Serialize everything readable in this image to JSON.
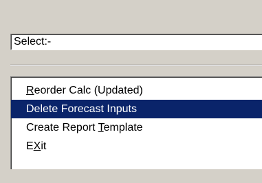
{
  "combo": {
    "value": "Select:-"
  },
  "menu": {
    "items": [
      {
        "pre": "",
        "key": "R",
        "post": "eorder Calc (Updated)",
        "selected": false
      },
      {
        "pre": "Delete Forecast Inputs",
        "key": "",
        "post": "",
        "selected": true
      },
      {
        "pre": "Create Report ",
        "key": "T",
        "post": "emplate",
        "selected": false
      },
      {
        "pre": "E",
        "key": "X",
        "post": "it",
        "selected": false
      }
    ]
  },
  "colors": {
    "window_bg": "#d4d0c8",
    "selection_bg": "#0a246a",
    "selection_text": "#ffffff"
  }
}
